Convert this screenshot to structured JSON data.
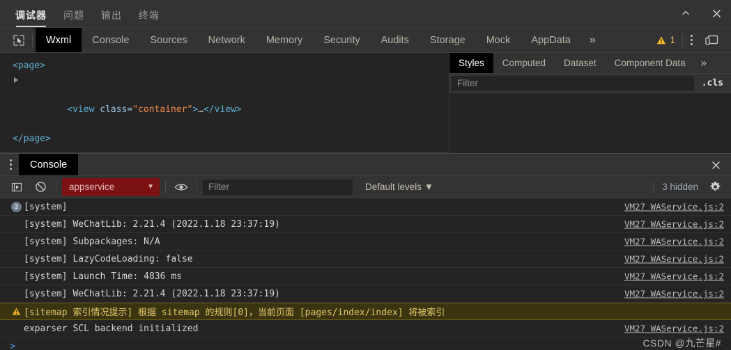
{
  "ide": {
    "tabs": [
      {
        "label": "调试器",
        "active": true
      },
      {
        "label": "问题",
        "active": false
      },
      {
        "label": "输出",
        "active": false
      },
      {
        "label": "终端",
        "active": false
      }
    ],
    "window_controls": {
      "collapse": "chevron-up",
      "close": "close"
    }
  },
  "devtools": {
    "inspect_icon": "inspect-cursor-icon",
    "tabs": [
      {
        "label": "Wxml",
        "active": true
      },
      {
        "label": "Console",
        "active": false
      },
      {
        "label": "Sources",
        "active": false
      },
      {
        "label": "Network",
        "active": false
      },
      {
        "label": "Memory",
        "active": false
      },
      {
        "label": "Security",
        "active": false
      },
      {
        "label": "Audits",
        "active": false
      },
      {
        "label": "Storage",
        "active": false
      },
      {
        "label": "Mock",
        "active": false
      },
      {
        "label": "AppData",
        "active": false
      }
    ],
    "more_label": "»",
    "warning_count": "1",
    "kebab_label": "more-options",
    "dock_label": "dock-side"
  },
  "dom_tree": {
    "lines": [
      {
        "indent": 0,
        "twisty": false,
        "parts": [
          {
            "t": "tag",
            "s": "<page>"
          }
        ]
      },
      {
        "indent": 1,
        "twisty": true,
        "parts": [
          {
            "t": "tag",
            "s": "<view "
          },
          {
            "t": "attr",
            "s": "class="
          },
          {
            "t": "val",
            "s": "\"container\""
          },
          {
            "t": "tag",
            "s": ">"
          },
          {
            "t": "dots",
            "s": "…"
          },
          {
            "t": "tag",
            "s": "</view>"
          }
        ]
      },
      {
        "indent": 0,
        "twisty": false,
        "parts": [
          {
            "t": "tag",
            "s": "</page>"
          }
        ]
      }
    ]
  },
  "styles_panel": {
    "tabs": [
      {
        "label": "Styles",
        "active": true
      },
      {
        "label": "Computed",
        "active": false
      },
      {
        "label": "Dataset",
        "active": false
      },
      {
        "label": "Component Data",
        "active": false
      }
    ],
    "more_label": "»",
    "filter_placeholder": "Filter",
    "filter_value": "",
    "cls_label": ".cls"
  },
  "drawer": {
    "tab_label": "Console",
    "close_label": "close-drawer",
    "toolbar": {
      "execution_icon": "execution-context-icon",
      "clear_icon": "clear-console-icon",
      "context_value": "appservice",
      "context_caret": "▼",
      "eye_icon": "live-expression-icon",
      "filter_placeholder": "Filter",
      "filter_value": "",
      "levels_label": "Default levels ▼",
      "hidden_label": "3 hidden",
      "settings_icon": "gear-icon"
    }
  },
  "console": {
    "messages": [
      {
        "badge": "3",
        "level": "info",
        "text": "[system]",
        "source": "VM27 WAService.js:2"
      },
      {
        "badge": "",
        "level": "info",
        "text": "[system] WeChatLib: 2.21.4 (2022.1.18 23:37:19)",
        "source": "VM27 WAService.js:2"
      },
      {
        "badge": "",
        "level": "info",
        "text": "[system] Subpackages: N/A",
        "source": "VM27 WAService.js:2"
      },
      {
        "badge": "",
        "level": "info",
        "text": "[system] LazyCodeLoading: false",
        "source": "VM27 WAService.js:2"
      },
      {
        "badge": "",
        "level": "info",
        "text": "[system] Launch Time: 4836 ms",
        "source": "VM27 WAService.js:2"
      },
      {
        "badge": "",
        "level": "info",
        "text": "[system] WeChatLib: 2.21.4 (2022.1.18 23:37:19)",
        "source": "VM27 WAService.js:2"
      },
      {
        "badge": "",
        "level": "warning",
        "text": "[sitemap 索引情况提示] 根据 sitemap 的规则[0]，当前页面 [pages/index/index] 将被索引",
        "source": ""
      },
      {
        "badge": "",
        "level": "info",
        "text": "exparser SCL backend initialized",
        "source": "VM27 WAService.js:2"
      }
    ],
    "prompt_caret": ">"
  },
  "watermark": "CSDN @九芒星#",
  "colors": {
    "accent_warning": "#e8c257",
    "context_badge_bg": "#7d1214",
    "warning_row_bg": "#3a3410",
    "panel_bg": "#242424",
    "chrome_bg": "#333333"
  }
}
